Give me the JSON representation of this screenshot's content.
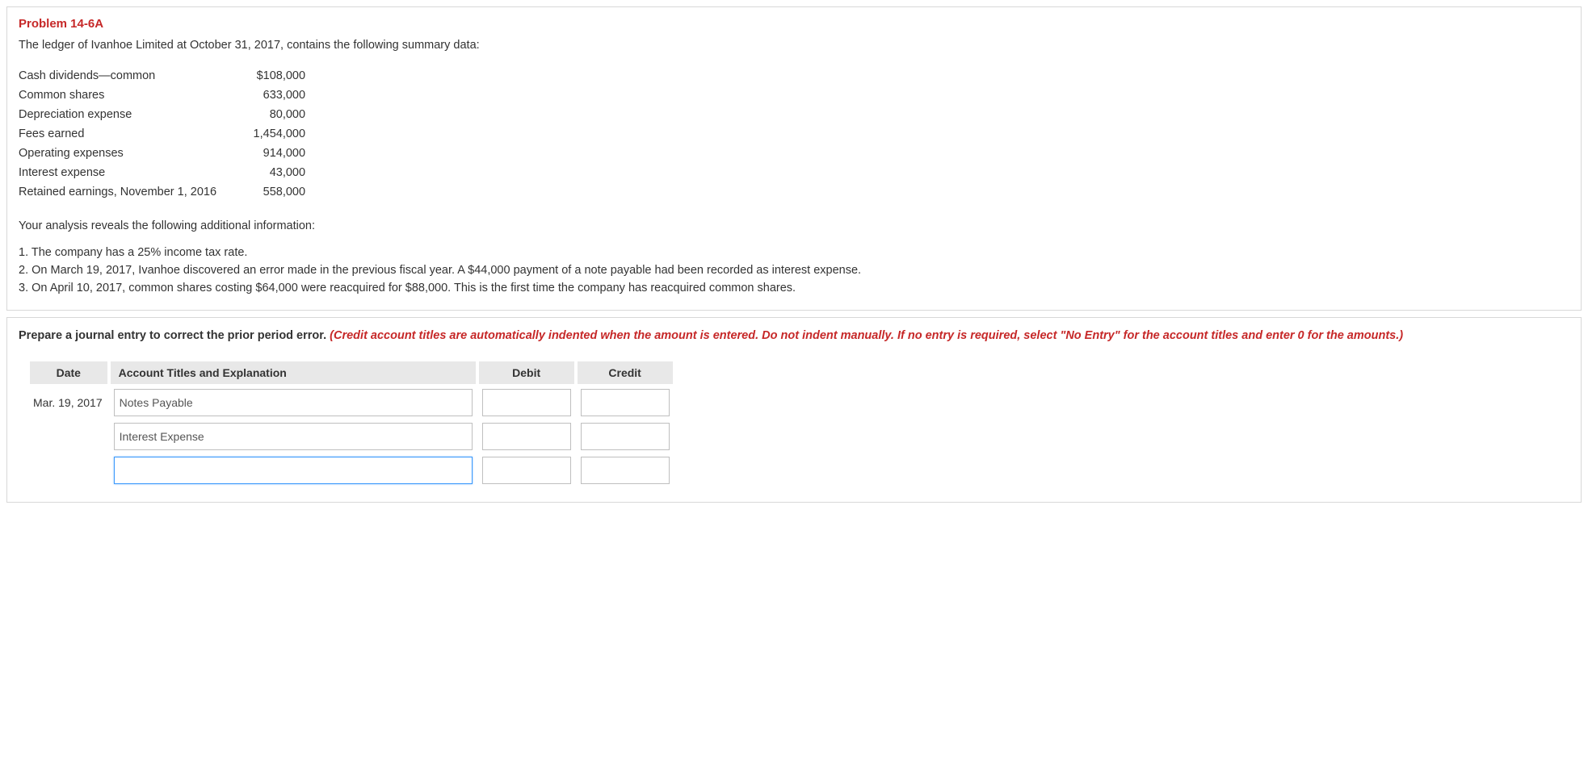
{
  "problem": {
    "title": "Problem 14-6A",
    "intro": "The ledger of Ivanhoe Limited at October 31, 2017, contains the following summary data:"
  },
  "ledger": [
    {
      "label": "Cash dividends—common",
      "amount": "$108,000"
    },
    {
      "label": "Common shares",
      "amount": "633,000"
    },
    {
      "label": "Depreciation expense",
      "amount": "80,000"
    },
    {
      "label": "Fees earned",
      "amount": "1,454,000"
    },
    {
      "label": "Operating expenses",
      "amount": "914,000"
    },
    {
      "label": "Interest expense",
      "amount": "43,000"
    },
    {
      "label": "Retained earnings, November 1, 2016",
      "amount": "558,000"
    }
  ],
  "subhead": "Your analysis reveals the following additional information:",
  "info": [
    "1. The company has a 25% income tax rate.",
    "2. On March 19, 2017, Ivanhoe discovered an error made in the previous fiscal year. A $44,000 payment of a note payable had been recorded as interest expense.",
    "3. On April 10, 2017, common shares costing $64,000 were reacquired for $88,000. This is the first time the company has reacquired common shares."
  ],
  "instruction": {
    "lead": "Prepare a journal entry to correct the prior period error. ",
    "note": "(Credit account titles are automatically indented when the amount is entered. Do not indent manually. If no entry is required, select \"No Entry\" for the account titles and enter 0 for the amounts.)"
  },
  "journal": {
    "headers": {
      "date": "Date",
      "account": "Account Titles and Explanation",
      "debit": "Debit",
      "credit": "Credit"
    },
    "rows": [
      {
        "date": "Mar. 19, 2017",
        "account": "Notes Payable",
        "debit": "",
        "credit": "",
        "focused": false
      },
      {
        "date": "",
        "account": "Interest Expense",
        "debit": "",
        "credit": "",
        "focused": false
      },
      {
        "date": "",
        "account": "",
        "debit": "",
        "credit": "",
        "focused": true
      }
    ]
  }
}
